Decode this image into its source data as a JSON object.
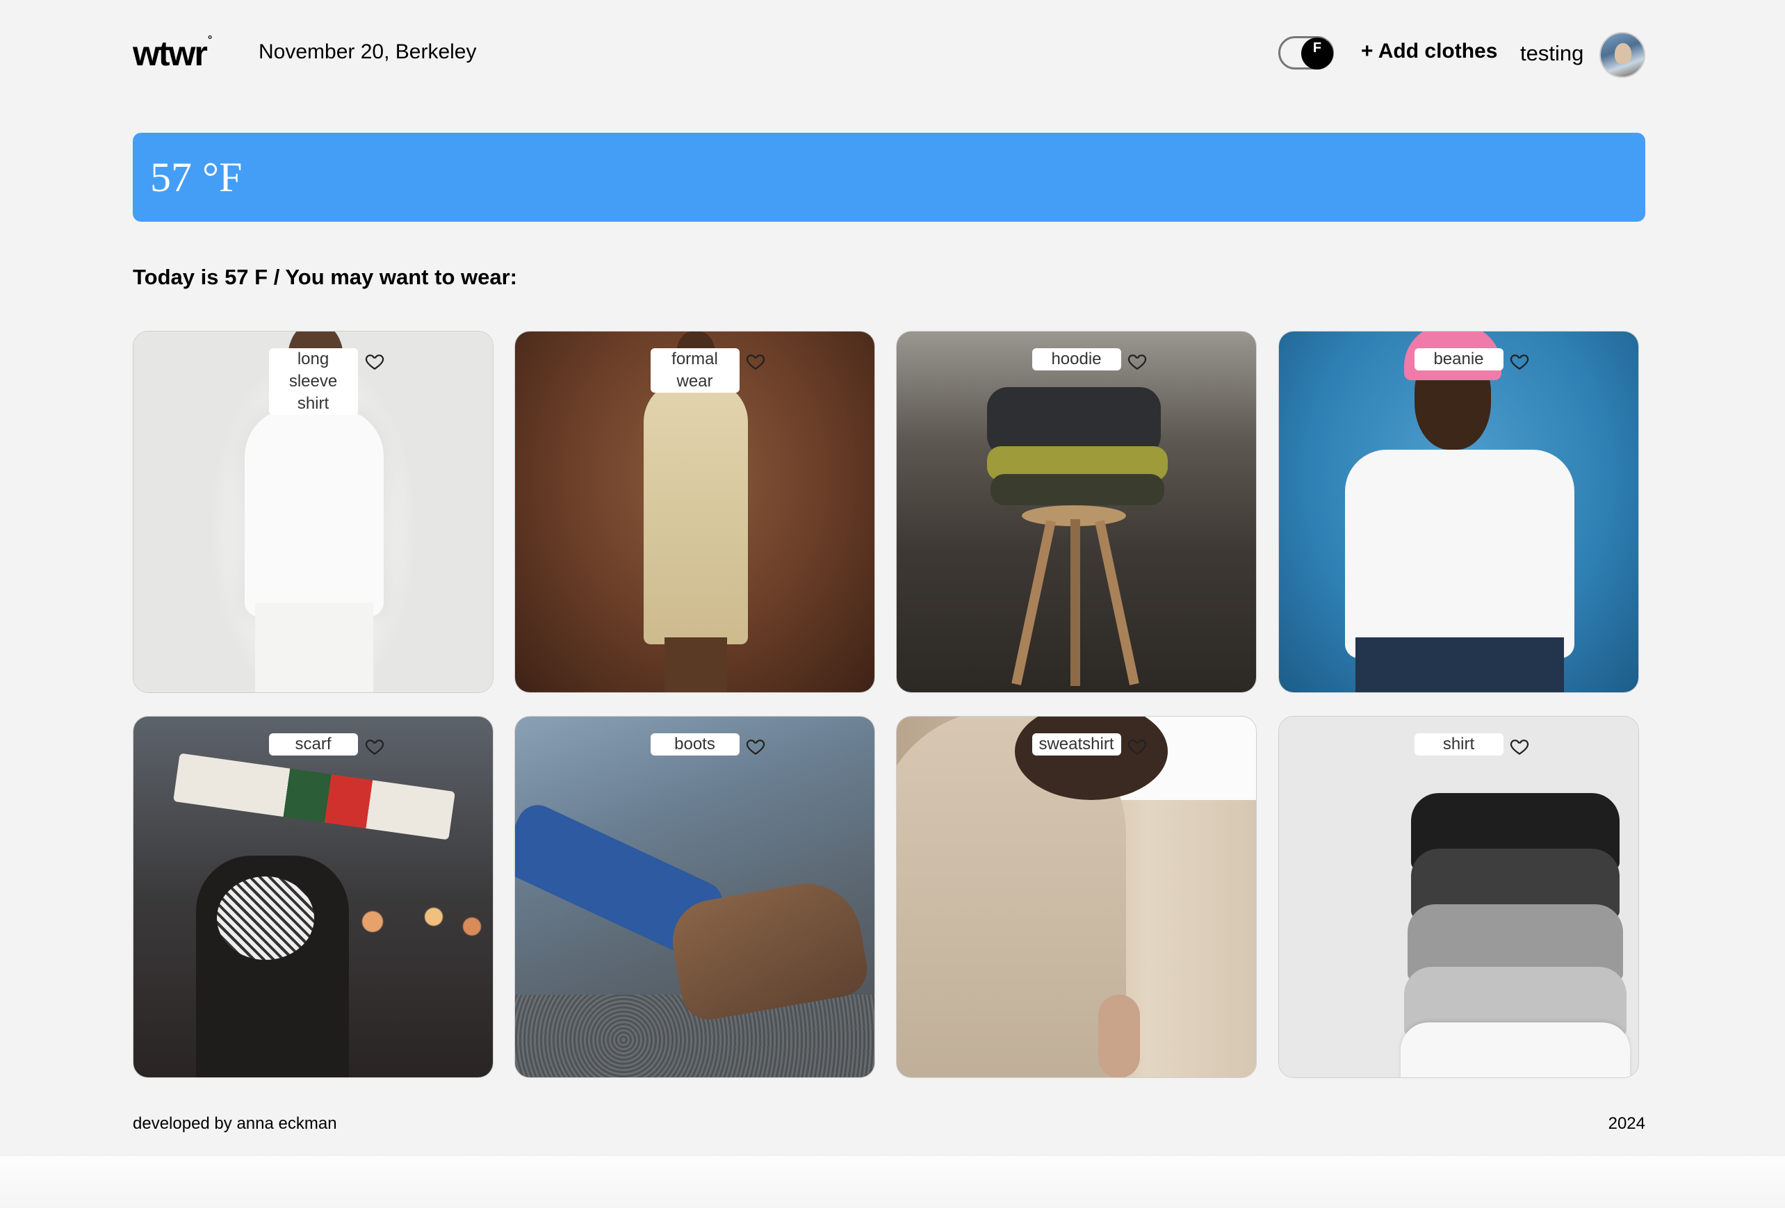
{
  "header": {
    "logo": "wtwr",
    "logo_mark": "°",
    "date_location": "November 20, Berkeley",
    "temp_unit_toggle": "F",
    "add_clothes_label": "+ Add clothes",
    "username": "testing"
  },
  "weather": {
    "temperature": "57 °F",
    "color": "#459ef5"
  },
  "suggestion_text": "Today is 57 F / You may want to wear:",
  "items": [
    {
      "label": "long sleeve shirt",
      "liked": false,
      "icon": "heart-outline-icon"
    },
    {
      "label": "formal wear",
      "liked": false,
      "icon": "heart-outline-icon"
    },
    {
      "label": "hoodie",
      "liked": false,
      "icon": "heart-outline-icon"
    },
    {
      "label": "beanie",
      "liked": false,
      "icon": "heart-outline-icon"
    },
    {
      "label": "scarf",
      "liked": false,
      "icon": "heart-outline-icon"
    },
    {
      "label": "boots",
      "liked": false,
      "icon": "heart-outline-icon"
    },
    {
      "label": "sweatshirt",
      "liked": false,
      "icon": "heart-outline-icon"
    },
    {
      "label": "shirt",
      "liked": false,
      "icon": "heart-outline-icon"
    }
  ],
  "footer": {
    "credit": "developed by anna eckman",
    "year": "2024"
  }
}
